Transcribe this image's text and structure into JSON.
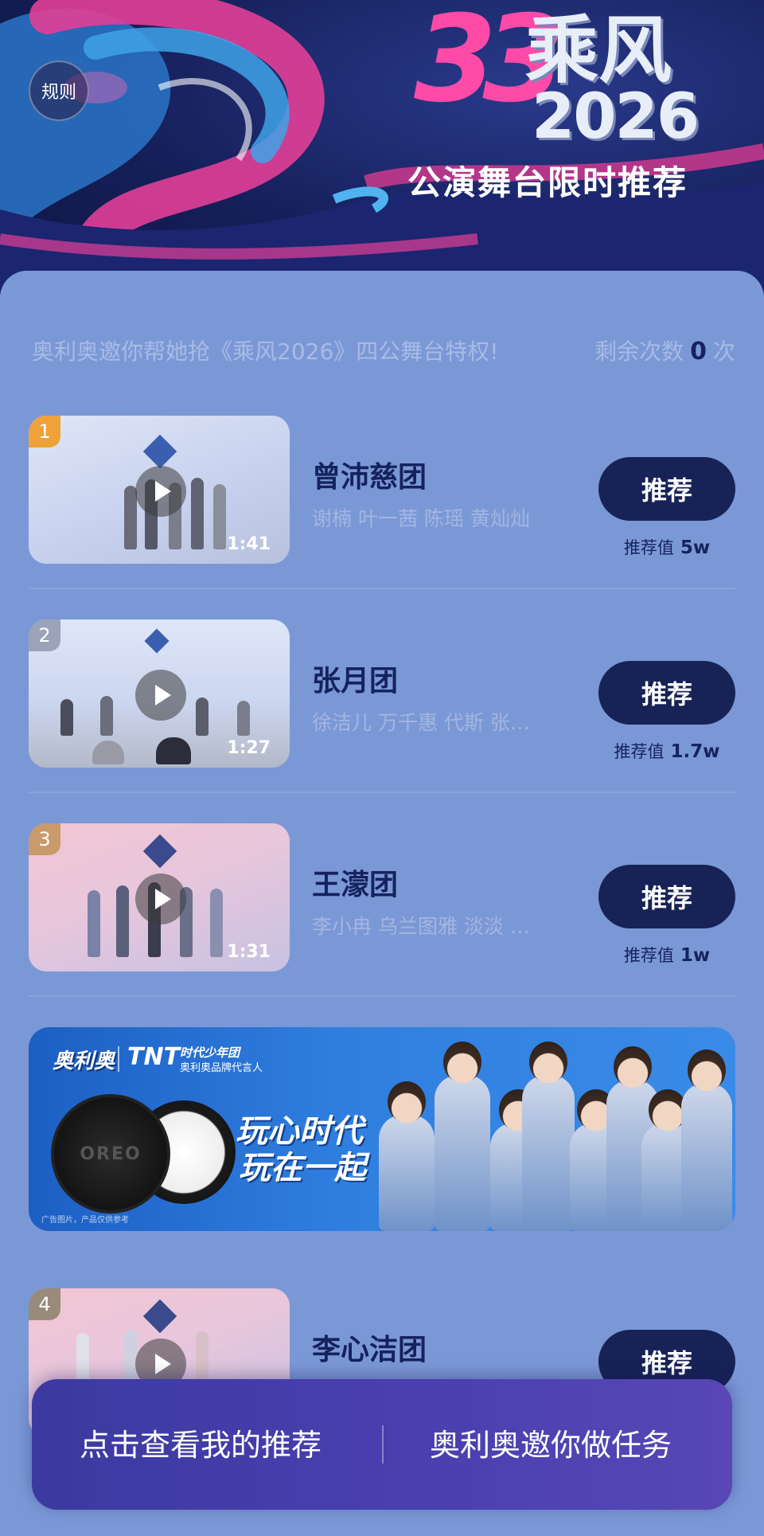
{
  "header": {
    "rules_label": "规则",
    "logo_number": "33",
    "logo_title": "乘风",
    "logo_year": "2026",
    "subtitle": "公演舞台限时推荐"
  },
  "notice": {
    "text": "奥利奥邀你帮她抢《乘风2026》四公舞台特权!",
    "remaining_label": "剩余次数",
    "remaining_value": "0",
    "remaining_unit": "次"
  },
  "entries": [
    {
      "rank": "1",
      "rank_color": "#f0a23a",
      "duration": "1:41",
      "team": "曾沛慈团",
      "members": "谢楠 叶一茜 陈瑶 黄灿灿",
      "button": "推荐",
      "score_label": "推荐值",
      "score": "5w"
    },
    {
      "rank": "2",
      "rank_color": "#9aa3b8",
      "duration": "1:27",
      "team": "张月团",
      "members": "徐洁儿 万千惠 代斯 张…",
      "button": "推荐",
      "score_label": "推荐值",
      "score": "1.7w"
    },
    {
      "rank": "3",
      "rank_color": "#c99a6a",
      "duration": "1:31",
      "team": "王濛团",
      "members": "李小冉 乌兰图雅 淡淡 …",
      "button": "推荐",
      "score_label": "推荐值",
      "score": "1w"
    },
    {
      "rank": "4",
      "rank_color": "#9a8a7a",
      "duration": "",
      "team": "李心洁团",
      "members": "",
      "button": "推荐",
      "score_label": "",
      "score": ""
    }
  ],
  "ad": {
    "brand": "奥利奥",
    "partner": "TNT",
    "partner_sub_1": "时代少年团",
    "partner_sub_2": "奥利奥品牌代言人",
    "slogan_line1": "玩心时代",
    "slogan_line2": "玩在一起",
    "cookie_text": "OREO",
    "fine_print": "广告图片，产品仅供参考"
  },
  "bottom_bar": {
    "left": "点击查看我的推荐",
    "right": "奥利奥邀你做任务"
  },
  "colors": {
    "panel": "#7b98d6",
    "button": "#172357",
    "accent_pink": "#ff4aa8"
  }
}
